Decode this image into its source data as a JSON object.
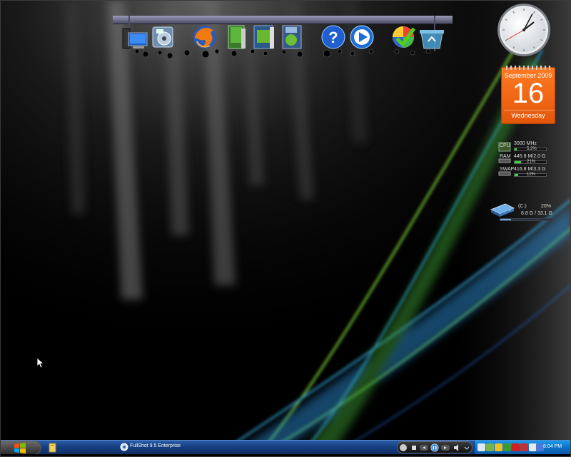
{
  "dock": {
    "items": [
      {
        "name": "my-computer",
        "icon": "computer-monitor-icon"
      },
      {
        "name": "media-center",
        "icon": "media-center-icon"
      },
      {
        "name": "firefox",
        "icon": "firefox-icon"
      },
      {
        "name": "bookmarks",
        "icon": "green-book-icon"
      },
      {
        "name": "library",
        "icon": "library-book-icon"
      },
      {
        "name": "media-book",
        "icon": "media-book-icon"
      },
      {
        "name": "help",
        "icon": "help-icon"
      },
      {
        "name": "media-player",
        "icon": "media-player-icon"
      },
      {
        "name": "windows-security",
        "icon": "checkmark-shield-icon"
      },
      {
        "name": "recycle-bin",
        "icon": "recycle-bin-icon"
      }
    ]
  },
  "calendar": {
    "month": "September 2009",
    "day": "16",
    "weekday": "Wednesday"
  },
  "clock": {
    "hour_hand_angle_deg": 52,
    "minute_hand_angle_deg": 28,
    "second_hand_angle_deg": 240
  },
  "meters": {
    "cpu": {
      "label": "CPU",
      "value": "3000 MHz",
      "percent_text": "5.2%",
      "percent": 5.2
    },
    "ram": {
      "label": "RAM",
      "value": "445.8 M/2.0 G",
      "percent_text": "21%",
      "percent": 21
    },
    "swap": {
      "label": "SWAP",
      "value": "416.8 M/3.3 G",
      "percent_text": "12%",
      "percent": 12
    }
  },
  "drive": {
    "label": "(C:)",
    "percent_text": "20%",
    "percent": 20,
    "size": "6.8 G / 33.1 G"
  },
  "taskbar": {
    "task_label": "FullShot 9.5 Enterprise",
    "time": "8:04 PM"
  },
  "colors": {
    "taskbar": "#163f82",
    "tray": "#0d6fc6",
    "calendar": "#f06a14",
    "meter_fill": "#39d04a"
  }
}
